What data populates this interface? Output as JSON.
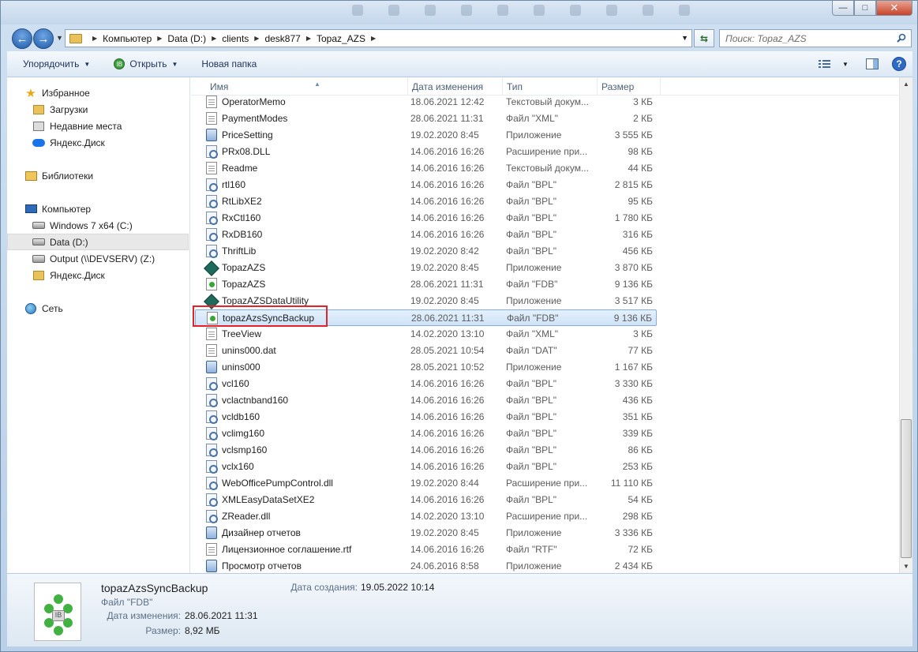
{
  "window": {
    "minimize": "—",
    "maximize": "□",
    "close": "✕"
  },
  "address": {
    "crumbs": [
      "Компьютер",
      "Data (D:)",
      "clients",
      "desk877",
      "Topaz_AZS"
    ],
    "search_placeholder": "Поиск: Topaz_AZS"
  },
  "toolbar": {
    "organize": "Упорядочить",
    "open": "Открыть",
    "new_folder": "Новая папка"
  },
  "navpane": {
    "favorites": "Избранное",
    "downloads": "Загрузки",
    "recent": "Недавние места",
    "yadisk1": "Яндекс.Диск",
    "libraries": "Библиотеки",
    "computer": "Компьютер",
    "drive_c": "Windows 7 x64 (C:)",
    "drive_d": "Data (D:)",
    "drive_z": "Output (\\\\DEVSERV) (Z:)",
    "yadisk2": "Яндекс.Диск",
    "network": "Сеть"
  },
  "columns": {
    "name": "Имя",
    "date": "Дата изменения",
    "type": "Тип",
    "size": "Размер"
  },
  "files": [
    {
      "name": "OperatorMemo",
      "date": "18.06.2021 12:42",
      "type": "Текстовый докум...",
      "size": "3 КБ",
      "icon": "doc"
    },
    {
      "name": "PaymentModes",
      "date": "28.06.2021 11:31",
      "type": "Файл \"XML\"",
      "size": "2 КБ",
      "icon": "doc"
    },
    {
      "name": "PriceSetting",
      "date": "19.02.2020 8:45",
      "type": "Приложение",
      "size": "3 555 КБ",
      "icon": "app"
    },
    {
      "name": "PRx08.DLL",
      "date": "14.06.2016 16:26",
      "type": "Расширение при...",
      "size": "98 КБ",
      "icon": "dll"
    },
    {
      "name": "Readme",
      "date": "14.06.2016 16:26",
      "type": "Текстовый докум...",
      "size": "44 КБ",
      "icon": "doc"
    },
    {
      "name": "rtl160",
      "date": "14.06.2016 16:26",
      "type": "Файл \"BPL\"",
      "size": "2 815 КБ",
      "icon": "dll"
    },
    {
      "name": "RtLibXE2",
      "date": "14.06.2016 16:26",
      "type": "Файл \"BPL\"",
      "size": "95 КБ",
      "icon": "dll"
    },
    {
      "name": "RxCtl160",
      "date": "14.06.2016 16:26",
      "type": "Файл \"BPL\"",
      "size": "1 780 КБ",
      "icon": "dll"
    },
    {
      "name": "RxDB160",
      "date": "14.06.2016 16:26",
      "type": "Файл \"BPL\"",
      "size": "316 КБ",
      "icon": "dll"
    },
    {
      "name": "ThriftLib",
      "date": "19.02.2020 8:42",
      "type": "Файл \"BPL\"",
      "size": "456 КБ",
      "icon": "dll"
    },
    {
      "name": "TopazAZS",
      "date": "19.02.2020 8:45",
      "type": "Приложение",
      "size": "3 870 КБ",
      "icon": "topaz"
    },
    {
      "name": "TopazAZS",
      "date": "28.06.2021 11:31",
      "type": "Файл \"FDB\"",
      "size": "9 136 КБ",
      "icon": "fdb"
    },
    {
      "name": "TopazAZSDataUtility",
      "date": "19.02.2020 8:45",
      "type": "Приложение",
      "size": "3 517 КБ",
      "icon": "topaz"
    },
    {
      "name": "topazAzsSyncBackup",
      "date": "28.06.2021 11:31",
      "type": "Файл \"FDB\"",
      "size": "9 136 КБ",
      "icon": "fdb"
    },
    {
      "name": "TreeView",
      "date": "14.02.2020 13:10",
      "type": "Файл \"XML\"",
      "size": "3 КБ",
      "icon": "doc"
    },
    {
      "name": "unins000.dat",
      "date": "28.05.2021 10:54",
      "type": "Файл \"DAT\"",
      "size": "77 КБ",
      "icon": "doc"
    },
    {
      "name": "unins000",
      "date": "28.05.2021 10:52",
      "type": "Приложение",
      "size": "1 167 КБ",
      "icon": "app"
    },
    {
      "name": "vcl160",
      "date": "14.06.2016 16:26",
      "type": "Файл \"BPL\"",
      "size": "3 330 КБ",
      "icon": "dll"
    },
    {
      "name": "vclactnband160",
      "date": "14.06.2016 16:26",
      "type": "Файл \"BPL\"",
      "size": "436 КБ",
      "icon": "dll"
    },
    {
      "name": "vcldb160",
      "date": "14.06.2016 16:26",
      "type": "Файл \"BPL\"",
      "size": "351 КБ",
      "icon": "dll"
    },
    {
      "name": "vclimg160",
      "date": "14.06.2016 16:26",
      "type": "Файл \"BPL\"",
      "size": "339 КБ",
      "icon": "dll"
    },
    {
      "name": "vclsmp160",
      "date": "14.06.2016 16:26",
      "type": "Файл \"BPL\"",
      "size": "86 КБ",
      "icon": "dll"
    },
    {
      "name": "vclx160",
      "date": "14.06.2016 16:26",
      "type": "Файл \"BPL\"",
      "size": "253 КБ",
      "icon": "dll"
    },
    {
      "name": "WebOfficePumpControl.dll",
      "date": "19.02.2020 8:44",
      "type": "Расширение при...",
      "size": "11 110 КБ",
      "icon": "dll"
    },
    {
      "name": "XMLEasyDataSetXE2",
      "date": "14.06.2016 16:26",
      "type": "Файл \"BPL\"",
      "size": "54 КБ",
      "icon": "dll"
    },
    {
      "name": "ZReader.dll",
      "date": "14.02.2020 13:10",
      "type": "Расширение при...",
      "size": "298 КБ",
      "icon": "dll"
    },
    {
      "name": "Дизайнер отчетов",
      "date": "19.02.2020 8:45",
      "type": "Приложение",
      "size": "3 336 КБ",
      "icon": "app"
    },
    {
      "name": "Лицензионное соглашение.rtf",
      "date": "14.06.2016 16:26",
      "type": "Файл \"RTF\"",
      "size": "72 КБ",
      "icon": "doc"
    },
    {
      "name": "Просмотр отчетов",
      "date": "24.06.2016 8:58",
      "type": "Приложение",
      "size": "2 434 КБ",
      "icon": "app"
    }
  ],
  "selected_index": 13,
  "details": {
    "name": "topazAzsSyncBackup",
    "type": "Файл \"FDB\"",
    "modified_label": "Дата изменения:",
    "modified_value": "28.06.2021 11:31",
    "size_label": "Размер:",
    "size_value": "8,92 МБ",
    "created_label": "Дата создания:",
    "created_value": "19.05.2022 10:14"
  },
  "colors": {
    "highlight_box": "#e4222a",
    "selection": "#cfe3f8"
  }
}
